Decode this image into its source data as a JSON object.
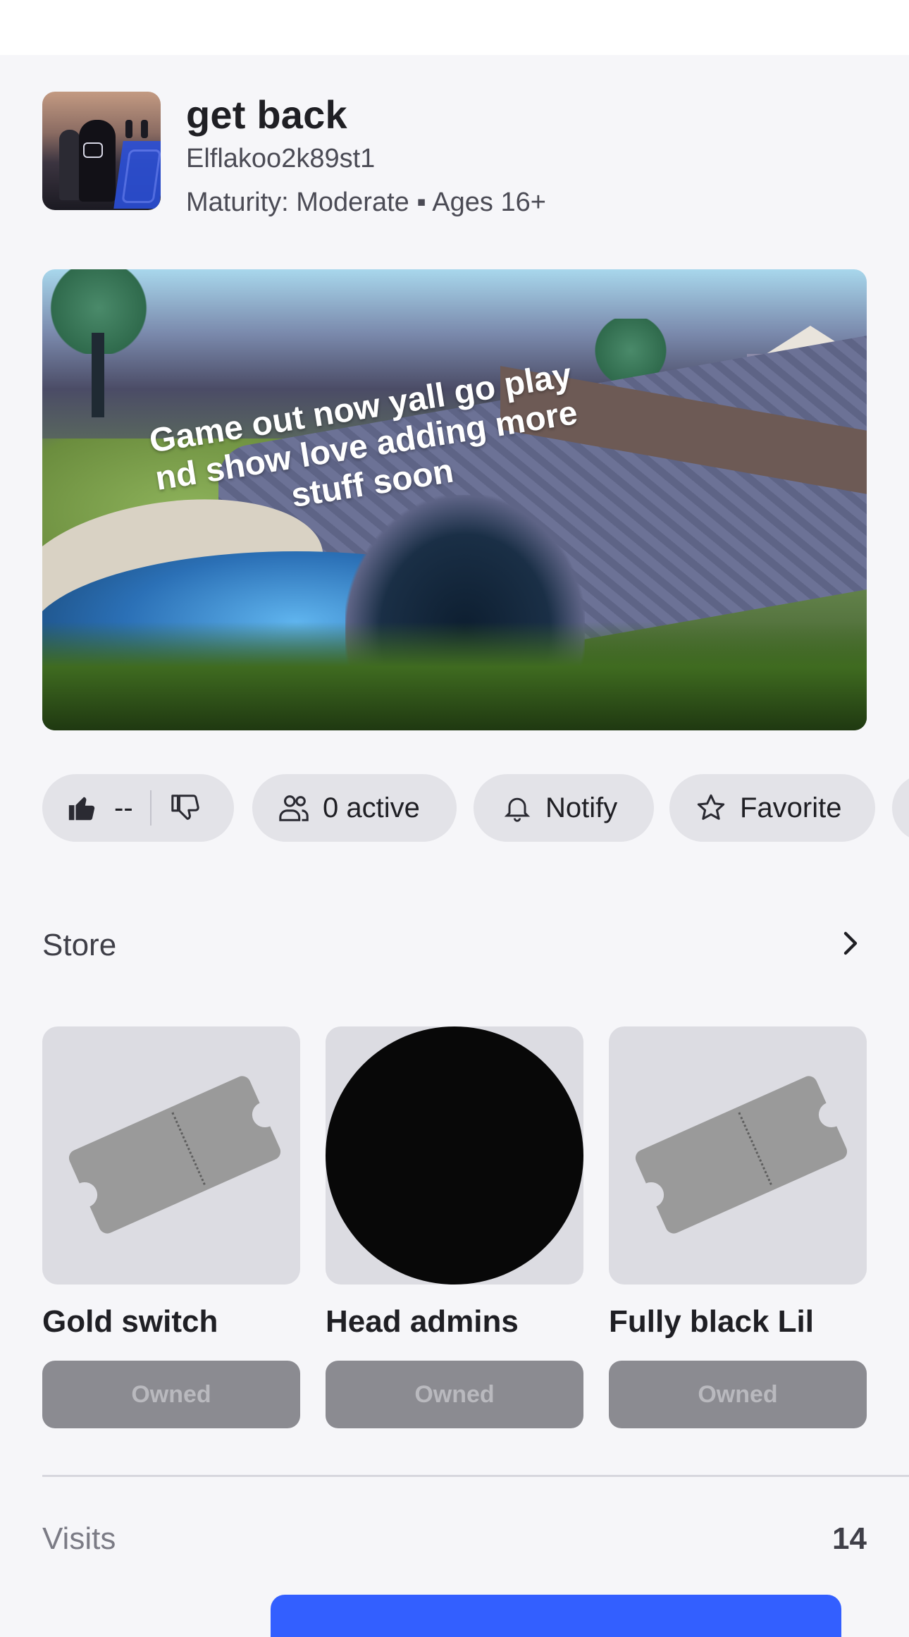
{
  "game": {
    "title": "get back",
    "creator": "Elflakoo2k89st1",
    "maturity": "Maturity: Moderate ▪ Ages 16+"
  },
  "hero": {
    "caption": "Game out now yall go play nd show love adding more stuff soon"
  },
  "actions": {
    "votes": "--",
    "active": "0 active",
    "notify": "Notify",
    "favorite": "Favorite"
  },
  "store": {
    "title": "Store",
    "items": [
      {
        "name": "Gold switch",
        "status": "Owned",
        "icon": "ticket-icon"
      },
      {
        "name": "Head admins",
        "status": "Owned",
        "icon": "black-circle-image"
      },
      {
        "name": "Fully black Lil",
        "status": "Owned",
        "icon": "ticket-icon"
      }
    ]
  },
  "stats": {
    "visits_label": "Visits",
    "visits_value": "14"
  },
  "colors": {
    "accent": "#335fff",
    "background": "#f6f6f9",
    "pill": "#e3e3e8"
  }
}
